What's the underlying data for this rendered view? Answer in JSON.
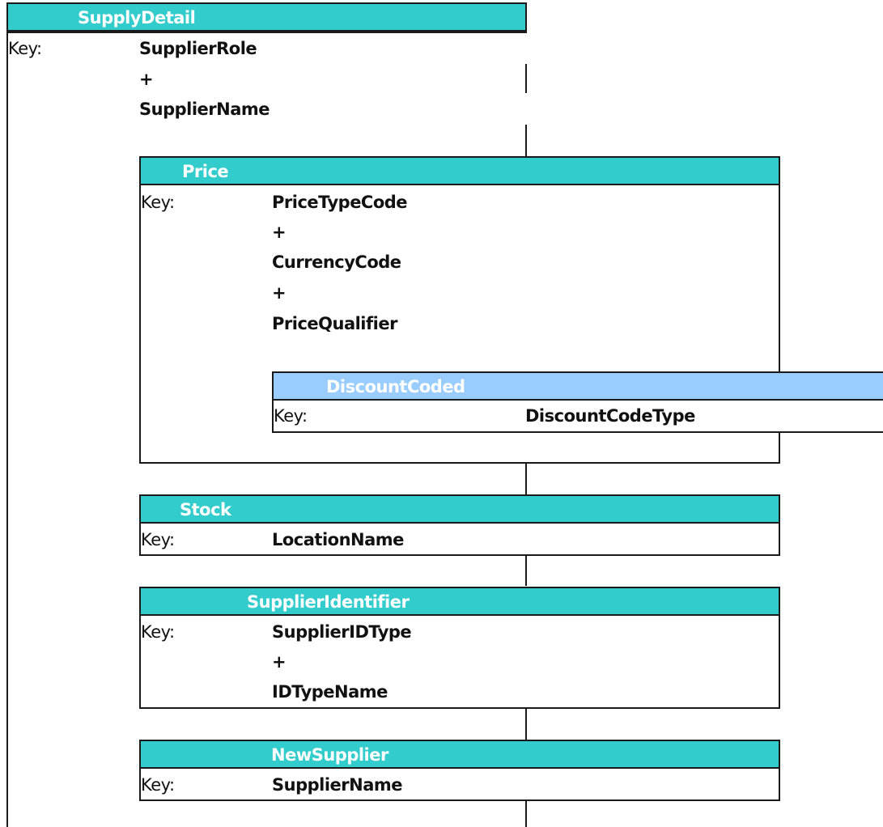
{
  "supply_detail": {
    "title": "SupplyDetail",
    "key_label": "Key:",
    "keys": [
      "SupplierRole",
      "+",
      "SupplierName"
    ]
  },
  "price": {
    "title": "Price",
    "key_label": "Key:",
    "keys": [
      "PriceTypeCode",
      "+",
      "CurrencyCode",
      "+",
      "PriceQualifier"
    ]
  },
  "discount_coded": {
    "title": "DiscountCoded",
    "key_label": "Key:",
    "keys": [
      "DiscountCodeType"
    ]
  },
  "stock": {
    "title": "Stock",
    "key_label": "Key:",
    "keys": [
      "LocationName"
    ]
  },
  "supplier_identifier": {
    "title": "SupplierIdentifier",
    "key_label": "Key:",
    "keys": [
      "SupplierIDType",
      "+",
      "IDTypeName"
    ]
  },
  "new_supplier": {
    "title": "NewSupplier",
    "key_label": "Key:",
    "keys": [
      "SupplierName"
    ]
  },
  "colors": {
    "teal_header": "#33CCCC",
    "blue_header": "#99CCFF",
    "border": "#1a1a1a"
  }
}
